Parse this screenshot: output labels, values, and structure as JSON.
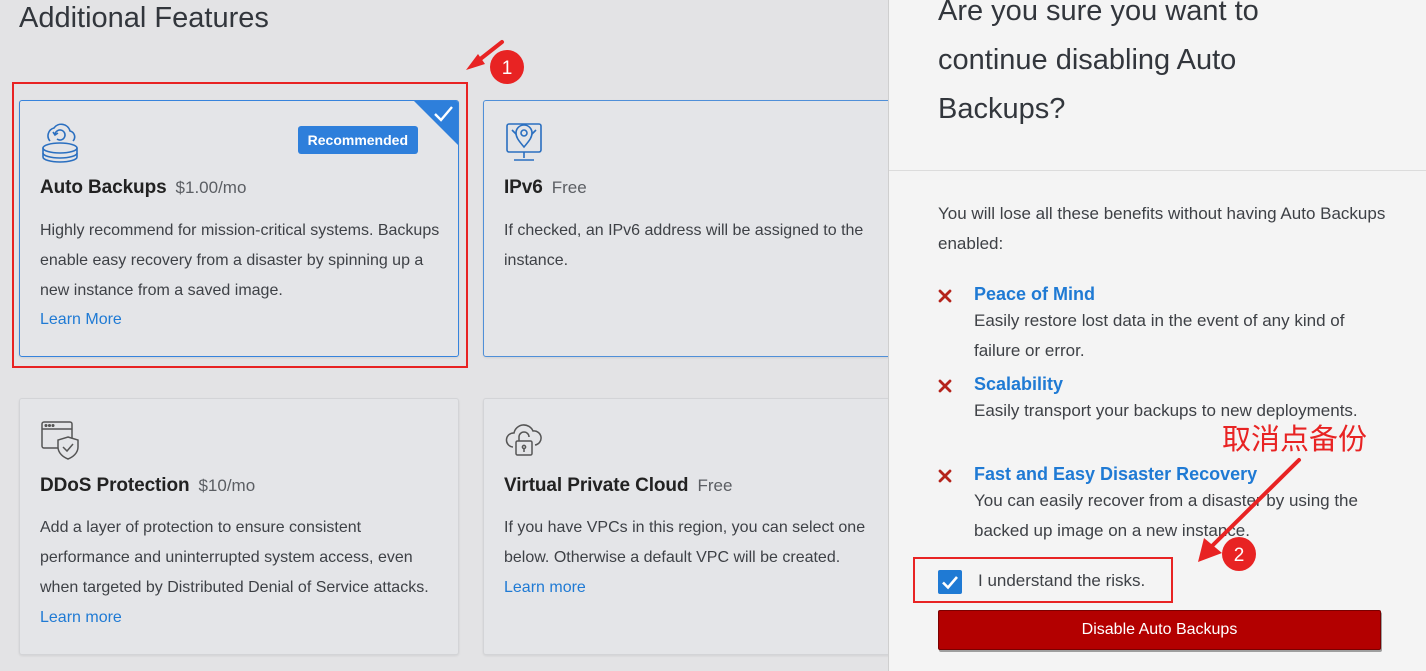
{
  "features": {
    "section_title": "Additional Features",
    "cards": [
      {
        "title": "Auto Backups",
        "price": "$1.00/mo",
        "badge": "Recommended",
        "desc": "Highly recommend for mission-critical systems. Backups enable easy recovery from a disaster by spinning up a new instance from a saved image.",
        "link": "Learn More",
        "selected": true,
        "icon": "backup-cloud-icon"
      },
      {
        "title": "IPv6",
        "price": "Free",
        "desc": "If checked, an IPv6 address will be assigned to the instance.",
        "icon": "network-location-icon"
      },
      {
        "title": "DDoS Protection",
        "price": "$10/mo",
        "desc": "Add a layer of protection to ensure consistent performance and uninterrupted system access, even when targeted by Distributed Denial of Service attacks.",
        "link": "Learn more",
        "icon": "shield-window-icon"
      },
      {
        "title": "Virtual Private Cloud",
        "price": "Free",
        "desc": "If you have VPCs in this region, you can select one below. Otherwise a default VPC will be created.",
        "link": "Learn more",
        "icon": "cloud-lock-icon"
      }
    ]
  },
  "dialog": {
    "title": "Are you sure you want to continue disabling Auto Backups?",
    "intro": "You will lose all these benefits without having Auto Backups enabled:",
    "benefits": [
      {
        "title": "Peace of Mind",
        "desc": "Easily restore lost data in the event of any kind of failure or error."
      },
      {
        "title": "Scalability",
        "desc": "Easily transport your backups to new deployments."
      },
      {
        "title": "Fast and Easy Disaster Recovery",
        "desc": "You can easily recover from a disaster by using the backed up image on a new instance."
      }
    ],
    "checkbox_label": "I understand the risks.",
    "checkbox_checked": true,
    "button_label": "Disable Auto Backups"
  },
  "annotations": {
    "step1": "1",
    "step2": "2",
    "note": "取消点备份"
  },
  "colors": {
    "accent": "#1f7ad4",
    "danger": "#b30000",
    "annotation": "#e82323",
    "x_mark": "#b5241c"
  }
}
